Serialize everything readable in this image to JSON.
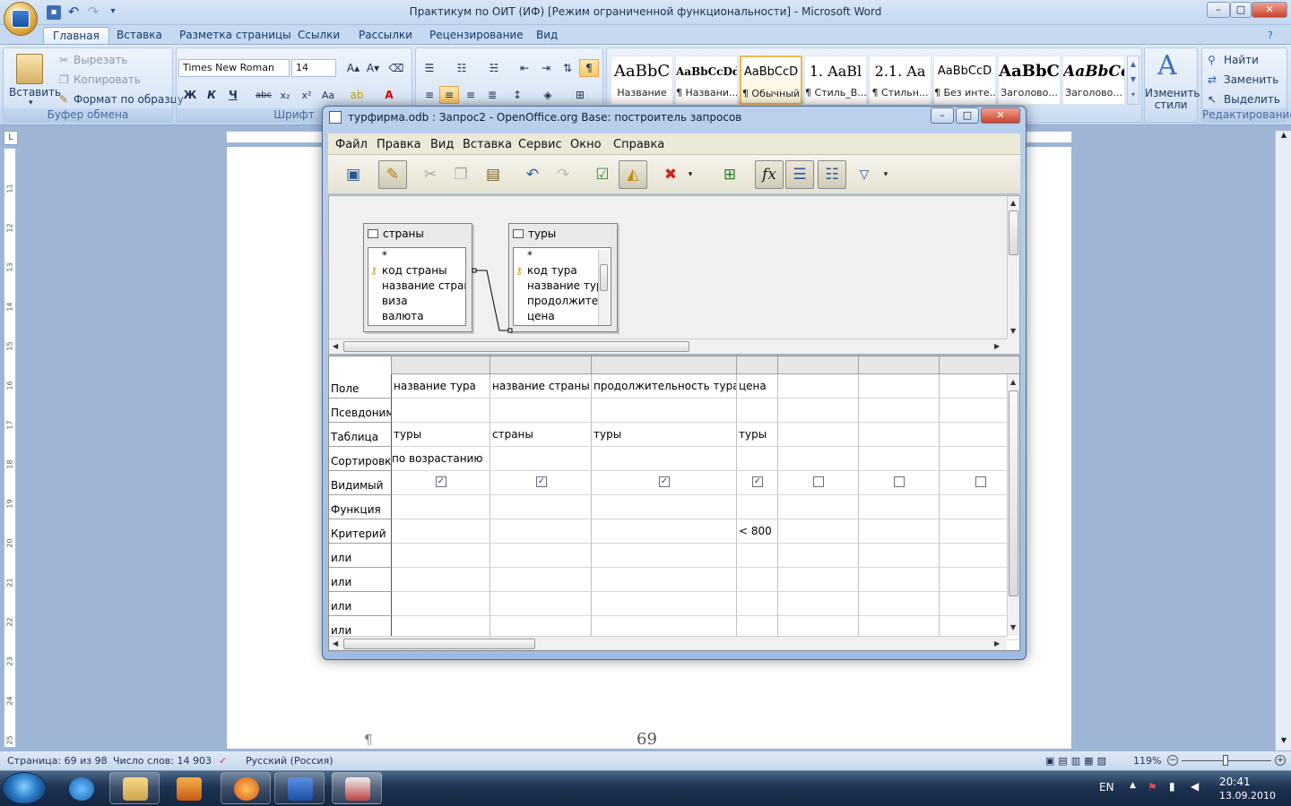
{
  "word": {
    "title": "Практикум по ОИТ (ИФ) [Режим ограниченной функциональности] - Microsoft Word",
    "tabs": [
      "Главная",
      "Вставка",
      "Разметка страницы",
      "Ссылки",
      "Рассылки",
      "Рецензирование",
      "Вид"
    ],
    "active_tab": "Главная",
    "clipboard": {
      "paste": "Вставить",
      "cut": "Вырезать",
      "copy": "Копировать",
      "format_painter": "Формат по образцу",
      "group": "Буфер обмена"
    },
    "font": {
      "name": "Times New Roman",
      "size": "14",
      "group": "Шрифт",
      "bold": "Ж",
      "italic": "К",
      "underline": "Ч"
    },
    "styles": [
      {
        "preview": "AaBbC",
        "label": "Название"
      },
      {
        "preview": "AaBbCcDd",
        "label": "¶ Названи..."
      },
      {
        "preview": "AaBbCcD",
        "label": "¶ Обычный"
      },
      {
        "preview": "1. AaBl",
        "label": "¶ Стиль_В..."
      },
      {
        "preview": "2.1. Aa",
        "label": "¶ Стильн..."
      },
      {
        "preview": "AaBbCcD",
        "label": "¶ Без инте..."
      },
      {
        "preview": "AaBbC",
        "label": "Заголово..."
      },
      {
        "preview": "AaBbCc",
        "label": "Заголово..."
      }
    ],
    "change_styles": "Изменить стили",
    "editing": {
      "find": "Найти",
      "replace": "Заменить",
      "select": "Выделить",
      "group": "Редактирование"
    },
    "page_number": "69",
    "pilcrow": "¶",
    "ruler_v": [
      "11",
      "12",
      "13",
      "14",
      "15",
      "16",
      "17",
      "18",
      "19",
      "20",
      "21",
      "22",
      "23",
      "24",
      "25"
    ],
    "status": {
      "page": "Страница: 69 из 98",
      "words": "Число слов: 14 903",
      "language": "Русский (Россия)",
      "zoom": "119%"
    }
  },
  "oo": {
    "title": "турфирма.odb : Запрос2 - OpenOffice.org Base: построитель запросов",
    "menu": [
      "Файл",
      "Правка",
      "Вид",
      "Вставка",
      "Сервис",
      "Окно",
      "Справка"
    ],
    "tables": [
      {
        "name": "страны",
        "fields": [
          "*",
          "код страны",
          "название стран",
          "виза",
          "валюта"
        ],
        "key_index": 1
      },
      {
        "name": "туры",
        "fields": [
          "*",
          "код тура",
          "название тур",
          "продолжите.",
          "цена"
        ],
        "key_index": 1
      }
    ],
    "row_labels": [
      "Поле",
      "Псевдоним",
      "Таблица",
      "Сортировка",
      "Видимый",
      "Функция",
      "Критерий",
      "или",
      "или",
      "или",
      "или"
    ],
    "columns": [
      {
        "field": "название тура",
        "alias": "",
        "table": "туры",
        "sort": "по возрастанию",
        "visible": true,
        "function": "",
        "criteria": ""
      },
      {
        "field": "название страны",
        "alias": "",
        "table": "страны",
        "sort": "",
        "visible": true,
        "function": "",
        "criteria": ""
      },
      {
        "field": "продолжительность тура",
        "alias": "",
        "table": "туры",
        "sort": "",
        "visible": true,
        "function": "",
        "criteria": ""
      },
      {
        "field": "цена",
        "alias": "",
        "table": "туры",
        "sort": "",
        "visible": true,
        "function": "",
        "criteria": "< 800"
      },
      {
        "field": "",
        "alias": "",
        "table": "",
        "sort": "",
        "visible": false,
        "function": "",
        "criteria": ""
      },
      {
        "field": "",
        "alias": "",
        "table": "",
        "sort": "",
        "visible": false,
        "function": "",
        "criteria": ""
      },
      {
        "field": "",
        "alias": "",
        "table": "",
        "sort": "",
        "visible": false,
        "function": "",
        "criteria": ""
      }
    ]
  },
  "taskbar": {
    "lang": "EN",
    "time": "20:41",
    "date": "13.09.2010"
  }
}
